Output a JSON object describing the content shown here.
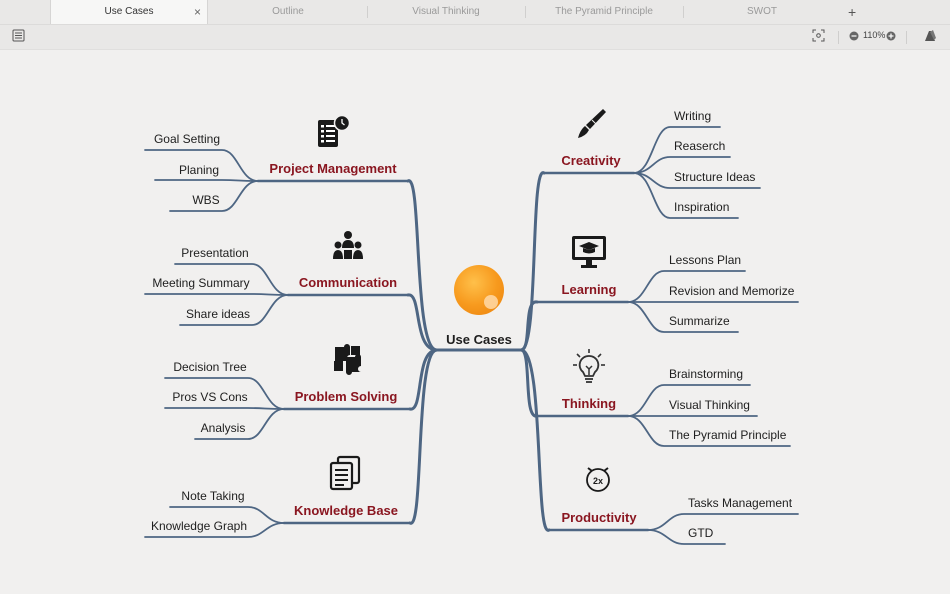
{
  "tabs": [
    {
      "label": "Use Cases",
      "active": true
    },
    {
      "label": "Outline"
    },
    {
      "label": "Visual Thinking"
    },
    {
      "label": "The Pyramid Principle"
    },
    {
      "label": "SWOT"
    }
  ],
  "tab_close": "×",
  "add_tab": "+",
  "toolbar": {
    "zoom": "110%"
  },
  "map": {
    "center": "Use Cases",
    "branch_color": "#4e6683",
    "topic_color": "#8a1620",
    "left": [
      {
        "title": "Project Management",
        "icon": "checklist-icon",
        "leaves": [
          "Goal Setting",
          "Planing",
          "WBS"
        ]
      },
      {
        "title": "Communication",
        "icon": "people-icon",
        "leaves": [
          "Presentation",
          "Meeting Summary",
          "Share ideas"
        ]
      },
      {
        "title": "Problem Solving",
        "icon": "puzzle-icon",
        "leaves": [
          "Decision Tree",
          "Pros VS Cons",
          "Analysis"
        ]
      },
      {
        "title": "Knowledge Base",
        "icon": "documents-icon",
        "leaves": [
          "Note Taking",
          "Knowledge Graph"
        ]
      }
    ],
    "right": [
      {
        "title": "Creativity",
        "icon": "brush-icon",
        "leaves": [
          "Writing",
          "Reaserch",
          "Structure Ideas",
          "Inspiration"
        ]
      },
      {
        "title": "Learning",
        "icon": "monitor-graduation-icon",
        "leaves": [
          "Lessons Plan",
          "Revision and Memorize",
          "Summarize"
        ]
      },
      {
        "title": "Thinking",
        "icon": "lightbulb-icon",
        "leaves": [
          "Brainstorming",
          "Visual Thinking",
          "The Pyramid Principle"
        ]
      },
      {
        "title": "Productivity",
        "icon": "stopwatch-2x-icon",
        "icon_text": "2x",
        "leaves": [
          "Tasks Management",
          "GTD"
        ]
      }
    ]
  }
}
